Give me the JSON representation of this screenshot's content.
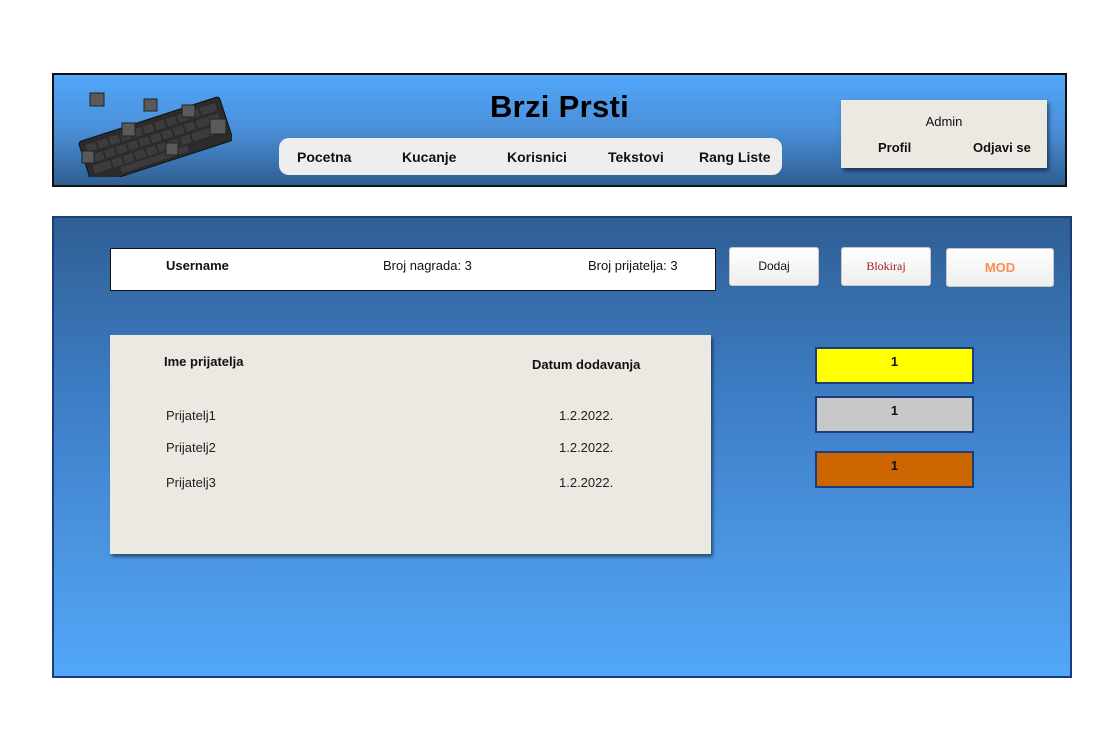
{
  "header": {
    "title": "Brzi Prsti",
    "nav": [
      "Pocetna",
      "Kucanje",
      "Korisnici",
      "Tekstovi",
      "Rang Liste"
    ],
    "user": {
      "name": "Admin",
      "profile_label": "Profil",
      "logout_label": "Odjavi se"
    }
  },
  "profile": {
    "username": "Username",
    "awards": "Broj nagrada: 3",
    "friends": "Broj prijatelja: 3"
  },
  "actions": {
    "add_label": "Dodaj",
    "block_label": "Blokiraj",
    "mod_label": "MOD",
    "block_color": "#a11a1a",
    "mod_color": "#ff8c50"
  },
  "friends_table": {
    "columns": [
      "Ime prijatelja",
      "Datum dodavanja"
    ],
    "rows": [
      {
        "name": "Prijatelj1",
        "date": "1.2.2022."
      },
      {
        "name": "Prijatelj2",
        "date": "1.2.2022."
      },
      {
        "name": "Prijatelj3",
        "date": "1.2.2022."
      }
    ]
  },
  "ranks": [
    {
      "value": "1",
      "color": "#ffff00"
    },
    {
      "value": "1",
      "color": "#c8c8c8"
    },
    {
      "value": "1",
      "color": "#cc6600"
    }
  ]
}
